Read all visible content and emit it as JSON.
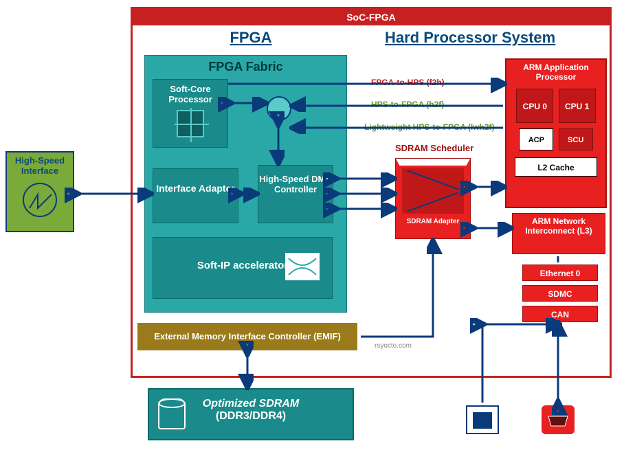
{
  "title": "SoC-FPGA",
  "fpga": {
    "title": "FPGA",
    "fabric_title": "FPGA Fabric",
    "soft_core": "Soft-Core Processor",
    "interface_adapter": "Interface Adapter",
    "dma": "High-Speed DMA Controller",
    "soft_ip": "Soft-IP accelerator",
    "emif": "External Memory Interface Controller (EMIF)"
  },
  "hps": {
    "title": "Hard Processor System",
    "arm_title": "ARM Application Processor",
    "cpu0": "CPU 0",
    "cpu1": "CPU 1",
    "acp": "ACP",
    "scu": "SCU",
    "l2": "L2 Cache",
    "sdram_sched": "SDRAM Scheduler",
    "sdram_adapter": "SDRAM Adapter",
    "l3": "ARM Network Interconnect (L3)",
    "eth": "Ethernet 0",
    "sdmc": "SDMC",
    "can": "CAN"
  },
  "bridges": {
    "f2h": "FPGA-to-HPS (f2h)",
    "h2f": "HPS-to-FPGA (h2f)",
    "lwh2f": "Lightweight HPS-to-FPGA (lwh2f)"
  },
  "external": {
    "hsi": "High-Speed Interface",
    "sdram_title": "Optimized SDRAM",
    "sdram_sub": "(DDR3/DDR4)"
  },
  "credit": "rsyocto.com"
}
